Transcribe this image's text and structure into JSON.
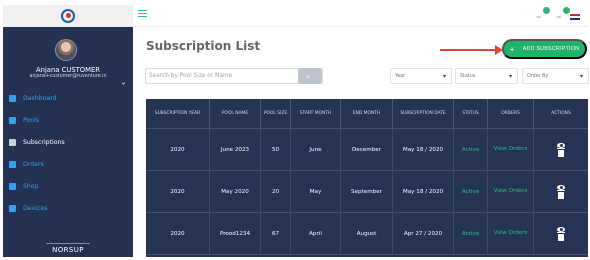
{
  "sidebar": {
    "user": {
      "name": "Anjana CUSTOMER",
      "email": "anjana+customer@ruventure.in"
    },
    "items": [
      {
        "label": "Dashboard",
        "active": false
      },
      {
        "label": "Pools",
        "active": false
      },
      {
        "label": "Subscriptions",
        "active": true
      },
      {
        "label": "Orders",
        "active": false
      },
      {
        "label": "Shop",
        "active": false
      },
      {
        "label": "Devices",
        "active": false
      }
    ],
    "brand": "NORSUP"
  },
  "header": {
    "notifications": [
      {
        "count": ""
      },
      {
        "count": ""
      }
    ]
  },
  "page": {
    "title": "Subscription List",
    "add_button": "ADD SUBSCRIPTION",
    "search_placeholder": "Search by Pool Size or Name",
    "filters": {
      "year": "Year",
      "status": "Status",
      "order_by": "Order By"
    }
  },
  "table": {
    "headers": [
      "SUBSCRIPTION YEAR",
      "POOL NAME",
      "POOL SIZE",
      "START MONTH",
      "END MONTH",
      "SUBSCRIPTION DATE",
      "STATUS",
      "ORDERS",
      "ACTIONS"
    ],
    "rows": [
      {
        "year": "2020",
        "pool": "June 2023",
        "size": "50",
        "start": "June",
        "end": "December",
        "date": "May 18 / 2020",
        "status": "Active",
        "orders": "View Orders"
      },
      {
        "year": "2020",
        "pool": "May 2020",
        "size": "20",
        "start": "May",
        "end": "September",
        "date": "May 18 / 2020",
        "status": "Active",
        "orders": "View Orders"
      },
      {
        "year": "2020",
        "pool": "Prood1234",
        "size": "67",
        "start": "April",
        "end": "August",
        "date": "Apr 27 / 2020",
        "status": "Active",
        "orders": "View Orders"
      }
    ]
  },
  "colors": {
    "sidebar_bg": "#243153",
    "accent_green": "#1fb36b",
    "table_bg": "#253355",
    "arrow_red": "#e5433b"
  }
}
